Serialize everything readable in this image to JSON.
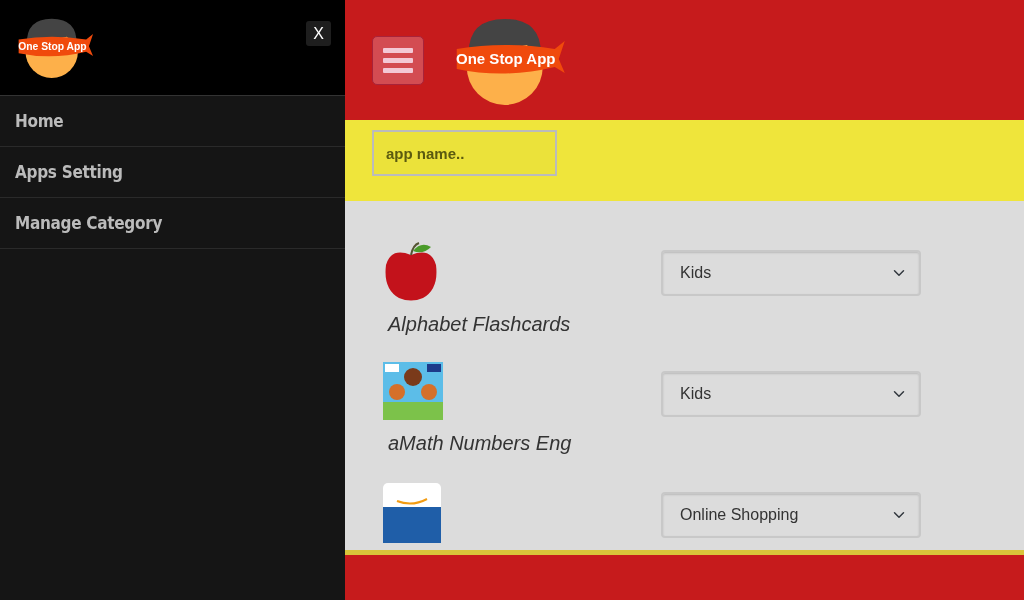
{
  "sidebar": {
    "logo_text": "One Stop App",
    "close_label": "X",
    "items": [
      {
        "label": "Home",
        "selected": false
      },
      {
        "label": "Apps Setting",
        "selected": false
      },
      {
        "label": "Manage Category",
        "selected": false
      }
    ]
  },
  "header": {
    "logo_text": "One Stop App"
  },
  "search": {
    "placeholder": "app name.."
  },
  "apps": [
    {
      "kind": "apple",
      "name": "Alphabet Flashcards",
      "category": "Kids"
    },
    {
      "kind": "math",
      "name": "aMath Numbers Eng",
      "category": "Kids"
    },
    {
      "kind": "shop",
      "category": "Online Shopping"
    }
  ]
}
